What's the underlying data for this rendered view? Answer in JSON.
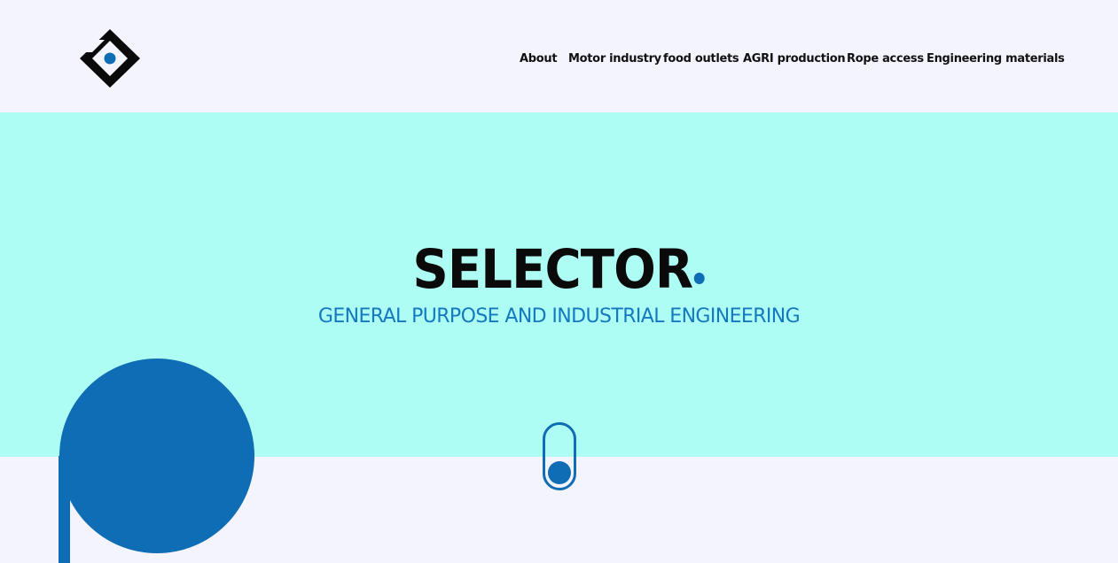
{
  "brand": {
    "logo_icon": "diamond-logo-icon",
    "accent_color": "#0f6db5",
    "dark_color": "#0a0a0a"
  },
  "nav": {
    "items": [
      {
        "label": "About"
      },
      {
        "label": "Motor industry"
      },
      {
        "label": "food outlets"
      },
      {
        "label": "AGRI production"
      },
      {
        "label": "Rope access"
      },
      {
        "label": "Engineering materials"
      }
    ]
  },
  "hero": {
    "title": "SELECTOR",
    "subtitle": "GENERAL PURPOSE AND INDUSTRIAL ENGINEERING",
    "background_color": "#aefdf4",
    "scroll_icon": "mouse-scroll-icon"
  },
  "page": {
    "background_color": "#f4f4fe"
  }
}
